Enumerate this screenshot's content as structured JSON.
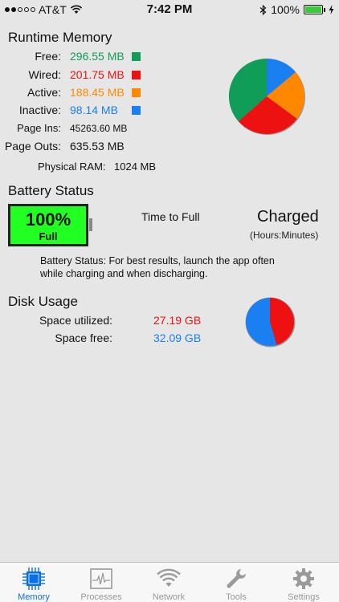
{
  "status_bar": {
    "carrier": "AT&T",
    "time": "7:42 PM",
    "battery_percent": "100%",
    "signal_bars": 2
  },
  "memory": {
    "title": "Runtime Memory",
    "rows": [
      {
        "label": "Free:",
        "value": "296.55 MB",
        "color": "#0f9d58"
      },
      {
        "label": "Wired:",
        "value": "201.75 MB",
        "color": "#ee1111"
      },
      {
        "label": "Active:",
        "value": "188.45 MB",
        "color": "#ff8800"
      },
      {
        "label": "Inactive:",
        "value": "98.14 MB",
        "color": "#1a7ff0"
      }
    ],
    "page_ins_label": "Page Ins:",
    "page_ins_value": "45263.60 MB",
    "page_outs_label": "Page Outs:",
    "page_outs_value": "635.53 MB",
    "physical_ram_label": "Physical RAM:",
    "physical_ram_value": "1024 MB"
  },
  "battery": {
    "title": "Battery Status",
    "percent": "100%",
    "state_short": "Full",
    "time_label": "Time to Full",
    "state": "Charged",
    "units": "(Hours:Minutes)",
    "note": "Battery Status: For best results, launch the app often while charging and when discharging."
  },
  "disk": {
    "title": "Disk Usage",
    "utilized_label": "Space utilized:",
    "utilized_value": "27.19 GB",
    "free_label": "Space free:",
    "free_value": "32.09 GB",
    "utilized_color": "#ee1111",
    "free_color": "#1a7ff0"
  },
  "tabs": [
    {
      "label": "Memory",
      "icon": "chip-icon",
      "active": true
    },
    {
      "label": "Processes",
      "icon": "pulse-icon",
      "active": false
    },
    {
      "label": "Network",
      "icon": "wifi-icon",
      "active": false
    },
    {
      "label": "Tools",
      "icon": "wrench-icon",
      "active": false
    },
    {
      "label": "Settings",
      "icon": "gear-icon",
      "active": false
    }
  ]
}
